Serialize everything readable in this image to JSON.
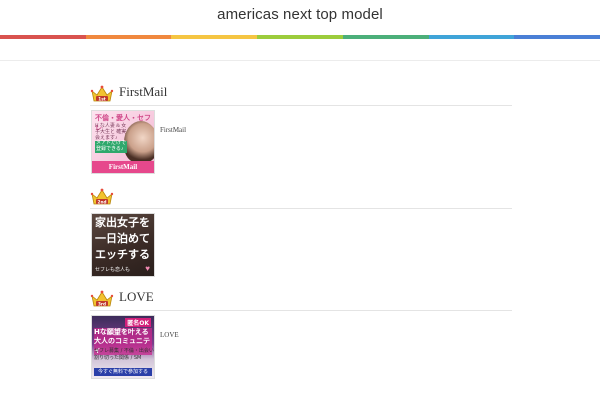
{
  "site": {
    "title": "americas next top model",
    "rainbow_colors": [
      "#d9534f",
      "#f0883e",
      "#f5c542",
      "#9ccc3c",
      "#4caf7a",
      "#3fa4d8",
      "#4a7fd6"
    ]
  },
  "rankings": [
    {
      "rank": 1,
      "title": "FirstMail",
      "caption": "FirstMail",
      "banner": {
        "top": "不倫・愛人・セフレ",
        "middle": "H な人妻 & 女子大生と 確実会えます♪",
        "green": "メアドだけで 登録できる♪",
        "logo": "FirstMail"
      }
    },
    {
      "rank": 2,
      "title": "",
      "caption": "",
      "banner": {
        "lines": [
          "家出女子を",
          "一日泊めて",
          "エッチする"
        ],
        "small": "セフレも恋人も",
        "heart": "♥"
      }
    },
    {
      "rank": 3,
      "title": "LOVE",
      "caption": "LOVE",
      "banner": {
        "tag": "匿名OK",
        "headline": "Hな願望を叶える 大人のコミュニティ",
        "sub": "セフレ募集 / 不倫・出会い 割り切った関係 / SM",
        "cta": "今すぐ無料で参加する"
      }
    }
  ]
}
